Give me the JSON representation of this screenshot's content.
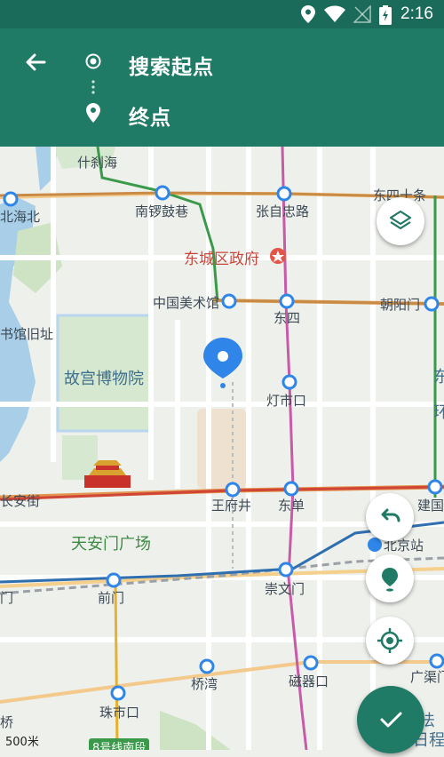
{
  "status_bar": {
    "time": "2:16"
  },
  "route": {
    "start_label": "搜索起点",
    "end_label": "终点"
  },
  "map": {
    "places": {
      "shichahai": "什刹海",
      "beihai": "北海北",
      "nanluoguxiang": "南锣鼓巷",
      "zhangzizhonglu": "张自忠路",
      "dongsishitiao": "东四十条",
      "dongcheng_gov": "东城区政府",
      "library": "书馆旧址",
      "art_museum": "中国美术馆",
      "dongsi": "东四",
      "chaoyangmen": "朝阳门",
      "palace_museum": "故宫博物院",
      "dengshikou": "灯市口",
      "east_edge": "东",
      "east_edge2": "环",
      "changan": "长安街",
      "wangfujing": "王府井",
      "dongdan": "东单",
      "jianguomen": "建国",
      "tiananmen_square": "天安门广场",
      "beijing_station": "北京站",
      "qianmen": "前门",
      "chongwenmen": "崇文门",
      "men_left": "门",
      "qiaowan": "桥湾",
      "ciqikou": "磁器口",
      "guangqumen": "广渠门",
      "zhushikou": "珠市口",
      "qiao_left": "桥",
      "line8": "8号线南段",
      "fa": "法",
      "richeng": "日程"
    },
    "scale": "500米"
  },
  "buttons": {
    "layers": "layers-icon",
    "undo": "undo-icon",
    "pin": "pin-icon",
    "locate": "locate-icon",
    "confirm": "check-icon"
  },
  "colors": {
    "header": "#1f7a66",
    "status": "#1b6b5a",
    "accent_blue": "#2f86e8"
  }
}
